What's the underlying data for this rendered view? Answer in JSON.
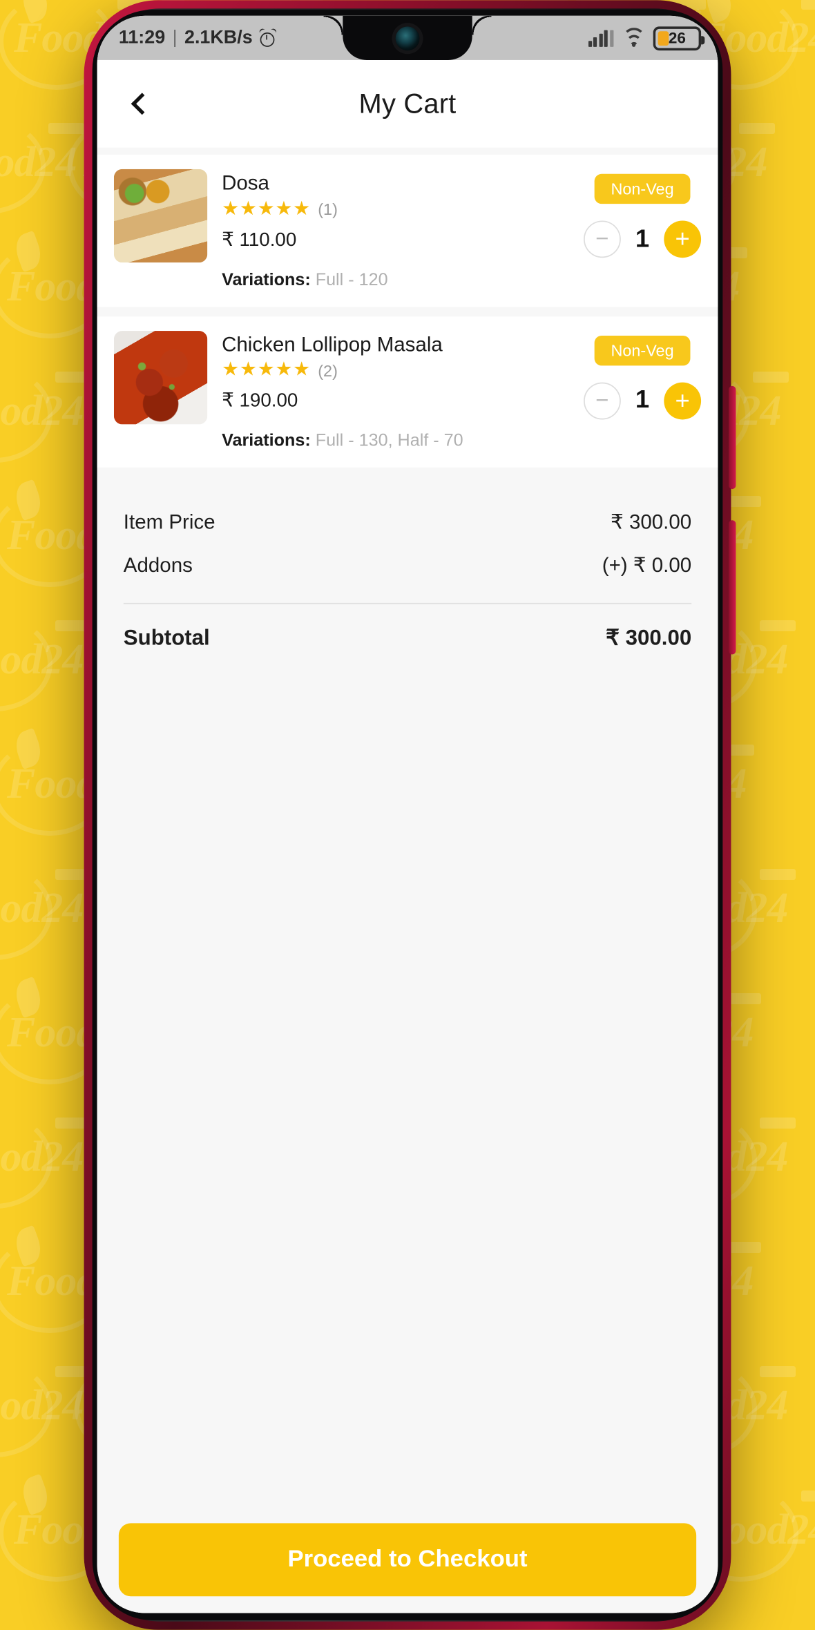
{
  "background": {
    "watermark_text": "Food24",
    "color": "#F9CE25"
  },
  "statusbar": {
    "time": "11:29",
    "separator": "|",
    "network_speed": "2.1KB/s",
    "alarm_icon": "alarm-clock-icon",
    "signal_icon": "cellular-signal-icon",
    "wifi_icon": "wifi-icon",
    "battery_level": "26",
    "battery_color": "#F2A81D"
  },
  "appbar": {
    "back_icon": "back-chevron-icon",
    "title": "My Cart"
  },
  "cart": {
    "items": [
      {
        "name": "Dosa",
        "stars": "★★★★★",
        "rating_count": "(1)",
        "price": "₹ 110.00",
        "variations_label": "Variations:",
        "variations_values": "Full - 120",
        "badge": "Non-Veg",
        "minus": "−",
        "quantity": "1",
        "plus": "+",
        "thumb": "dosa-image"
      },
      {
        "name": "Chicken Lollipop Masala",
        "stars": "★★★★★",
        "rating_count": "(2)",
        "price": "₹ 190.00",
        "variations_label": "Variations:",
        "variations_values": "Full - 130,  Half - 70",
        "badge": "Non-Veg",
        "minus": "−",
        "quantity": "1",
        "plus": "+",
        "thumb": "chicken-lollipop-image"
      }
    ]
  },
  "summary": {
    "item_price_label": "Item Price",
    "item_price_value": "₹ 300.00",
    "addons_label": "Addons",
    "addons_value": "(+) ₹ 0.00",
    "subtotal_label": "Subtotal",
    "subtotal_value": "₹ 300.00"
  },
  "footer": {
    "checkout_label": "Proceed to Checkout",
    "accent_color": "#F9C406"
  }
}
